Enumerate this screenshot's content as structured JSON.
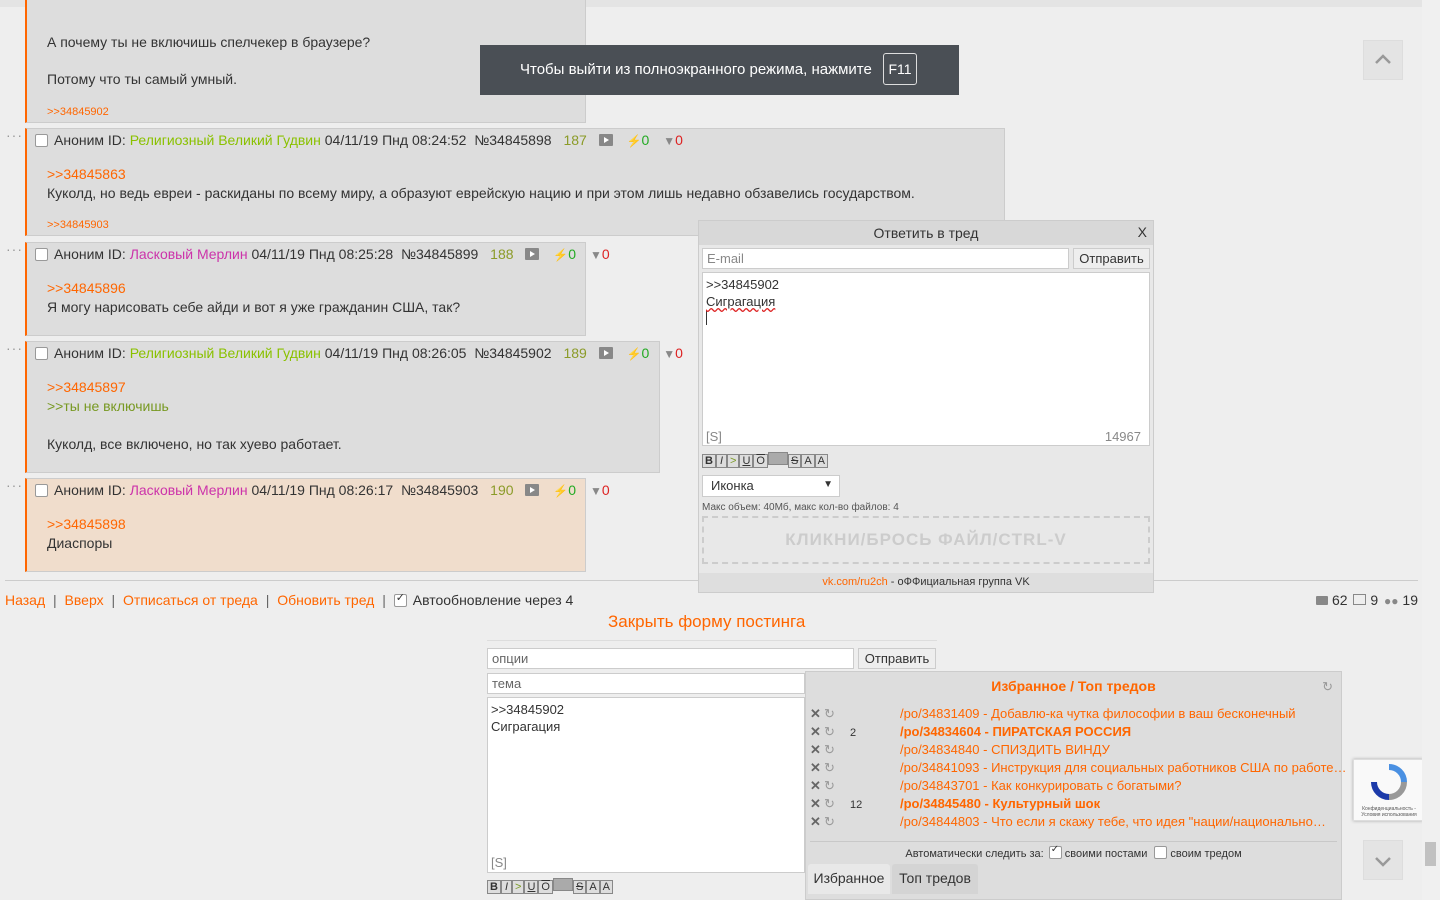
{
  "fullscreen_notice": {
    "text": "Чтобы выйти из полноэкранного режима, нажмите",
    "key": "F11"
  },
  "top_post": {
    "line1": "А почему ты не включишь спелчекер в браузере?",
    "line2": "Потому что ты самый умный.",
    "reply": ">>34845902"
  },
  "posts": [
    {
      "anon": "Аноним ID:",
      "name": "Религиозный Великий Гудвин",
      "date": "04/11/19 Пнд 08:24:52",
      "num": "№34845898",
      "count": "187",
      "up": "0",
      "down": "0",
      "ref1": ">>34845863",
      "text": "Куколд, но ведь евреи - раскиданы по всему миру, а образуют еврейскую нацию и при этом лишь недавно обзавелись государством.",
      "reply": ">>34845903"
    },
    {
      "anon": "Аноним ID:",
      "name": "Ласковый Мерлин",
      "date": "04/11/19 Пнд 08:25:28",
      "num": "№34845899",
      "count": "188",
      "up": "0",
      "down": "0",
      "ref1": ">>34845896",
      "text": "Я могу нарисовать себе айди и вот я уже гражданин США, так?"
    },
    {
      "anon": "Аноним ID:",
      "name": "Религиозный Великий Гудвин",
      "date": "04/11/19 Пнд 08:26:05",
      "num": "№34845902",
      "count": "189",
      "up": "0",
      "down": "0",
      "ref1": ">>34845897",
      "quote": ">>ты не включишь",
      "text": "Куколд, все включено, но так хуево работает."
    },
    {
      "anon": "Аноним ID:",
      "name": "Ласковый Мерлин",
      "date": "04/11/19 Пнд 08:26:17",
      "num": "№34845903",
      "count": "190",
      "up": "0",
      "down": "0",
      "ref1": ">>34845898",
      "text": "Диаспоры"
    }
  ],
  "bottom_nav": {
    "back": "Назад",
    "top": "Вверх",
    "unsub": "Отписаться от треда",
    "refresh": "Обновить тред",
    "auto": "Автообновление через 4",
    "stat_posts": "62",
    "stat_images": "9",
    "stat_users": "19"
  },
  "close_form": "Закрыть форму постинга",
  "quick_reply": {
    "title": "Ответить в тред",
    "close": "X",
    "email_placeholder": "E-mail",
    "send": "Отправить",
    "text_line1": ">>34845902",
    "text_line2": "Сиграгация",
    "spoiler": "[S]",
    "counter": "14967",
    "icon_select": "Иконка",
    "limits": "Макс объем: 40Мб, макс кол-во файлов: 4",
    "dropzone": "КЛИКНИ/БРОСЬ ФАЙЛ/CTRL-V",
    "vk_link": "vk.com/ru2ch",
    "vk_text": " - оФФициальная группа VK"
  },
  "main_form": {
    "options_placeholder": "опции",
    "send": "Отправить",
    "subject_placeholder": "тема",
    "text_line1": ">>34845902",
    "text_line2": "Сиграгация",
    "spoiler": "[S]"
  },
  "format_buttons": [
    "B",
    "I",
    ">",
    "U",
    "O",
    "",
    "S",
    "A",
    "A"
  ],
  "favorites": {
    "title": "Избранное / Топ тредов",
    "items": [
      {
        "count": "",
        "text": "/po/34831409 - Добавлю-ка чутка философии в ваш бесконечный",
        "bold": false
      },
      {
        "count": "2",
        "text": "/po/34834604 - ПИРАТСКАЯ РОССИЯ",
        "bold": true
      },
      {
        "count": "",
        "text": "/po/34834840 - СПИЗДИТЬ ВИНДУ",
        "bold": false
      },
      {
        "count": "",
        "text": "/po/34841093 - Инструкция для социальных работников США по работе…",
        "bold": false
      },
      {
        "count": "",
        "text": "/po/34843701 - Как конкурировать с богатыми?",
        "bold": false
      },
      {
        "count": "12",
        "text": "/po/34845480 - Культурный шок",
        "bold": true
      },
      {
        "count": "",
        "text": "/po/34844803 - Что если я скажу тебе, что идея \"нации/национально…",
        "bold": false
      }
    ],
    "auto_label": "Автоматически следить за:",
    "own_posts": "своими постами",
    "own_thread": "своим тредом",
    "tab_fav": "Избранное",
    "tab_top": "Топ тредов"
  },
  "recaptcha": {
    "text": "Конфиденциальность - Условия использования"
  },
  "colors": {
    "accent": "#ff6600",
    "green_name": "#8ac100",
    "pink_name": "#cc33aa",
    "count": "#8b9b28"
  }
}
